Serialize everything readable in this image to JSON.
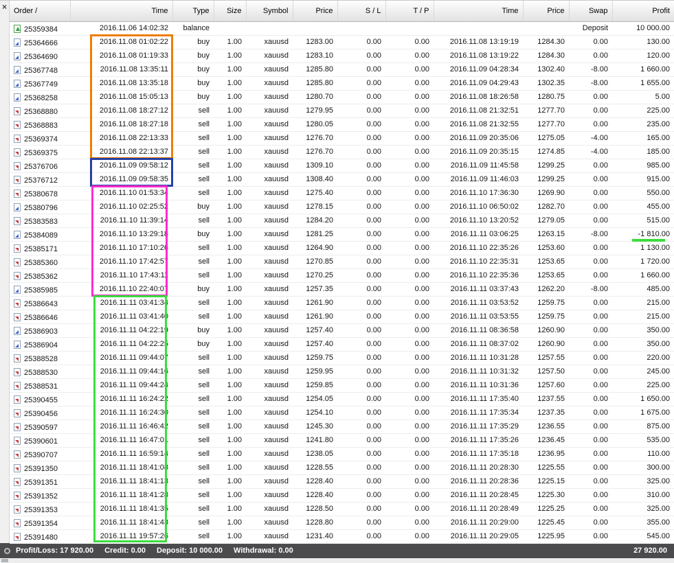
{
  "panel": {
    "close_glyph": "×"
  },
  "columns": [
    {
      "key": "order",
      "label": "Order /"
    },
    {
      "key": "time",
      "label": "Time"
    },
    {
      "key": "type",
      "label": "Type"
    },
    {
      "key": "size",
      "label": "Size"
    },
    {
      "key": "symbol",
      "label": "Symbol"
    },
    {
      "key": "price",
      "label": "Price"
    },
    {
      "key": "sl",
      "label": "S / L"
    },
    {
      "key": "tp",
      "label": "T / P"
    },
    {
      "key": "time2",
      "label": "Time"
    },
    {
      "key": "price2",
      "label": "Price"
    },
    {
      "key": "swap",
      "label": "Swap"
    },
    {
      "key": "profit",
      "label": "Profit"
    }
  ],
  "rows": [
    {
      "order": "25359384",
      "time": "2016.11.06 14:02:32",
      "type": "balance",
      "size": "",
      "symbol": "",
      "price": "",
      "sl": "",
      "tp": "",
      "time2": "",
      "price2": "",
      "swap": "Deposit",
      "profit": "10 000.00"
    },
    {
      "order": "25364666",
      "time": "2016.11.08 01:02:22",
      "type": "buy",
      "size": "1.00",
      "symbol": "xauusd",
      "price": "1283.00",
      "sl": "0.00",
      "tp": "0.00",
      "time2": "2016.11.08 13:19:19",
      "price2": "1284.30",
      "swap": "0.00",
      "profit": "130.00"
    },
    {
      "order": "25364690",
      "time": "2016.11.08 01:19:33",
      "type": "buy",
      "size": "1.00",
      "symbol": "xauusd",
      "price": "1283.10",
      "sl": "0.00",
      "tp": "0.00",
      "time2": "2016.11.08 13:19:22",
      "price2": "1284.30",
      "swap": "0.00",
      "profit": "120.00"
    },
    {
      "order": "25367748",
      "time": "2016.11.08 13:35:11",
      "type": "buy",
      "size": "1.00",
      "symbol": "xauusd",
      "price": "1285.80",
      "sl": "0.00",
      "tp": "0.00",
      "time2": "2016.11.09 04:28:34",
      "price2": "1302.40",
      "swap": "-8.00",
      "profit": "1 660.00"
    },
    {
      "order": "25367749",
      "time": "2016.11.08 13:35:18",
      "type": "buy",
      "size": "1.00",
      "symbol": "xauusd",
      "price": "1285.80",
      "sl": "0.00",
      "tp": "0.00",
      "time2": "2016.11.09 04:29:43",
      "price2": "1302.35",
      "swap": "-8.00",
      "profit": "1 655.00"
    },
    {
      "order": "25368258",
      "time": "2016.11.08 15:05:13",
      "type": "buy",
      "size": "1.00",
      "symbol": "xauusd",
      "price": "1280.70",
      "sl": "0.00",
      "tp": "0.00",
      "time2": "2016.11.08 18:26:58",
      "price2": "1280.75",
      "swap": "0.00",
      "profit": "5.00"
    },
    {
      "order": "25368880",
      "time": "2016.11.08 18:27:12",
      "type": "sell",
      "size": "1.00",
      "symbol": "xauusd",
      "price": "1279.95",
      "sl": "0.00",
      "tp": "0.00",
      "time2": "2016.11.08 21:32:51",
      "price2": "1277.70",
      "swap": "0.00",
      "profit": "225.00"
    },
    {
      "order": "25368883",
      "time": "2016.11.08 18:27:18",
      "type": "sell",
      "size": "1.00",
      "symbol": "xauusd",
      "price": "1280.05",
      "sl": "0.00",
      "tp": "0.00",
      "time2": "2016.11.08 21:32:55",
      "price2": "1277.70",
      "swap": "0.00",
      "profit": "235.00"
    },
    {
      "order": "25369374",
      "time": "2016.11.08 22:13:33",
      "type": "sell",
      "size": "1.00",
      "symbol": "xauusd",
      "price": "1276.70",
      "sl": "0.00",
      "tp": "0.00",
      "time2": "2016.11.09 20:35:06",
      "price2": "1275.05",
      "swap": "-4.00",
      "profit": "165.00"
    },
    {
      "order": "25369375",
      "time": "2016.11.08 22:13:37",
      "type": "sell",
      "size": "1.00",
      "symbol": "xauusd",
      "price": "1276.70",
      "sl": "0.00",
      "tp": "0.00",
      "time2": "2016.11.09 20:35:15",
      "price2": "1274.85",
      "swap": "-4.00",
      "profit": "185.00"
    },
    {
      "order": "25376706",
      "time": "2016.11.09 09:58:12",
      "type": "sell",
      "size": "1.00",
      "symbol": "xauusd",
      "price": "1309.10",
      "sl": "0.00",
      "tp": "0.00",
      "time2": "2016.11.09 11:45:58",
      "price2": "1299.25",
      "swap": "0.00",
      "profit": "985.00"
    },
    {
      "order": "25376712",
      "time": "2016.11.09 09:58:35",
      "type": "sell",
      "size": "1.00",
      "symbol": "xauusd",
      "price": "1308.40",
      "sl": "0.00",
      "tp": "0.00",
      "time2": "2016.11.09 11:46:03",
      "price2": "1299.25",
      "swap": "0.00",
      "profit": "915.00"
    },
    {
      "order": "25380678",
      "time": "2016.11.10 01:53:34",
      "type": "sell",
      "size": "1.00",
      "symbol": "xauusd",
      "price": "1275.40",
      "sl": "0.00",
      "tp": "0.00",
      "time2": "2016.11.10 17:36:30",
      "price2": "1269.90",
      "swap": "0.00",
      "profit": "550.00"
    },
    {
      "order": "25380796",
      "time": "2016.11.10 02:25:52",
      "type": "buy",
      "size": "1.00",
      "symbol": "xauusd",
      "price": "1278.15",
      "sl": "0.00",
      "tp": "0.00",
      "time2": "2016.11.10 06:50:02",
      "price2": "1282.70",
      "swap": "0.00",
      "profit": "455.00"
    },
    {
      "order": "25383583",
      "time": "2016.11.10 11:39:14",
      "type": "sell",
      "size": "1.00",
      "symbol": "xauusd",
      "price": "1284.20",
      "sl": "0.00",
      "tp": "0.00",
      "time2": "2016.11.10 13:20:52",
      "price2": "1279.05",
      "swap": "0.00",
      "profit": "515.00"
    },
    {
      "order": "25384089",
      "time": "2016.11.10 13:29:18",
      "type": "buy",
      "size": "1.00",
      "symbol": "xauusd",
      "price": "1281.25",
      "sl": "0.00",
      "tp": "0.00",
      "time2": "2016.11.11 03:06:25",
      "price2": "1263.15",
      "swap": "-8.00",
      "profit": "-1 810.00"
    },
    {
      "order": "25385171",
      "time": "2016.11.10 17:10:26",
      "type": "sell",
      "size": "1.00",
      "symbol": "xauusd",
      "price": "1264.90",
      "sl": "0.00",
      "tp": "0.00",
      "time2": "2016.11.10 22:35:26",
      "price2": "1253.60",
      "swap": "0.00",
      "profit": "1 130.00"
    },
    {
      "order": "25385360",
      "time": "2016.11.10 17:42:57",
      "type": "sell",
      "size": "1.00",
      "symbol": "xauusd",
      "price": "1270.85",
      "sl": "0.00",
      "tp": "0.00",
      "time2": "2016.11.10 22:35:31",
      "price2": "1253.65",
      "swap": "0.00",
      "profit": "1 720.00"
    },
    {
      "order": "25385362",
      "time": "2016.11.10 17:43:11",
      "type": "sell",
      "size": "1.00",
      "symbol": "xauusd",
      "price": "1270.25",
      "sl": "0.00",
      "tp": "0.00",
      "time2": "2016.11.10 22:35:36",
      "price2": "1253.65",
      "swap": "0.00",
      "profit": "1 660.00"
    },
    {
      "order": "25385985",
      "time": "2016.11.10 22:40:07",
      "type": "buy",
      "size": "1.00",
      "symbol": "xauusd",
      "price": "1257.35",
      "sl": "0.00",
      "tp": "0.00",
      "time2": "2016.11.11 03:37:43",
      "price2": "1262.20",
      "swap": "-8.00",
      "profit": "485.00"
    },
    {
      "order": "25386643",
      "time": "2016.11.11 03:41:34",
      "type": "sell",
      "size": "1.00",
      "symbol": "xauusd",
      "price": "1261.90",
      "sl": "0.00",
      "tp": "0.00",
      "time2": "2016.11.11 03:53:52",
      "price2": "1259.75",
      "swap": "0.00",
      "profit": "215.00"
    },
    {
      "order": "25386646",
      "time": "2016.11.11 03:41:40",
      "type": "sell",
      "size": "1.00",
      "symbol": "xauusd",
      "price": "1261.90",
      "sl": "0.00",
      "tp": "0.00",
      "time2": "2016.11.11 03:53:55",
      "price2": "1259.75",
      "swap": "0.00",
      "profit": "215.00"
    },
    {
      "order": "25386903",
      "time": "2016.11.11 04:22:19",
      "type": "buy",
      "size": "1.00",
      "symbol": "xauusd",
      "price": "1257.40",
      "sl": "0.00",
      "tp": "0.00",
      "time2": "2016.11.11 08:36:58",
      "price2": "1260.90",
      "swap": "0.00",
      "profit": "350.00"
    },
    {
      "order": "25386904",
      "time": "2016.11.11 04:22:25",
      "type": "buy",
      "size": "1.00",
      "symbol": "xauusd",
      "price": "1257.40",
      "sl": "0.00",
      "tp": "0.00",
      "time2": "2016.11.11 08:37:02",
      "price2": "1260.90",
      "swap": "0.00",
      "profit": "350.00"
    },
    {
      "order": "25388528",
      "time": "2016.11.11 09:44:07",
      "type": "sell",
      "size": "1.00",
      "symbol": "xauusd",
      "price": "1259.75",
      "sl": "0.00",
      "tp": "0.00",
      "time2": "2016.11.11 10:31:28",
      "price2": "1257.55",
      "swap": "0.00",
      "profit": "220.00"
    },
    {
      "order": "25388530",
      "time": "2016.11.11 09:44:16",
      "type": "sell",
      "size": "1.00",
      "symbol": "xauusd",
      "price": "1259.95",
      "sl": "0.00",
      "tp": "0.00",
      "time2": "2016.11.11 10:31:32",
      "price2": "1257.50",
      "swap": "0.00",
      "profit": "245.00"
    },
    {
      "order": "25388531",
      "time": "2016.11.11 09:44:24",
      "type": "sell",
      "size": "1.00",
      "symbol": "xauusd",
      "price": "1259.85",
      "sl": "0.00",
      "tp": "0.00",
      "time2": "2016.11.11 10:31:36",
      "price2": "1257.60",
      "swap": "0.00",
      "profit": "225.00"
    },
    {
      "order": "25390455",
      "time": "2016.11.11 16:24:22",
      "type": "sell",
      "size": "1.00",
      "symbol": "xauusd",
      "price": "1254.05",
      "sl": "0.00",
      "tp": "0.00",
      "time2": "2016.11.11 17:35:40",
      "price2": "1237.55",
      "swap": "0.00",
      "profit": "1 650.00"
    },
    {
      "order": "25390456",
      "time": "2016.11.11 16:24:30",
      "type": "sell",
      "size": "1.00",
      "symbol": "xauusd",
      "price": "1254.10",
      "sl": "0.00",
      "tp": "0.00",
      "time2": "2016.11.11 17:35:34",
      "price2": "1237.35",
      "swap": "0.00",
      "profit": "1 675.00"
    },
    {
      "order": "25390597",
      "time": "2016.11.11 16:46:42",
      "type": "sell",
      "size": "1.00",
      "symbol": "xauusd",
      "price": "1245.30",
      "sl": "0.00",
      "tp": "0.00",
      "time2": "2016.11.11 17:35:29",
      "price2": "1236.55",
      "swap": "0.00",
      "profit": "875.00"
    },
    {
      "order": "25390601",
      "time": "2016.11.11 16:47:01",
      "type": "sell",
      "size": "1.00",
      "symbol": "xauusd",
      "price": "1241.80",
      "sl": "0.00",
      "tp": "0.00",
      "time2": "2016.11.11 17:35:26",
      "price2": "1236.45",
      "swap": "0.00",
      "profit": "535.00"
    },
    {
      "order": "25390707",
      "time": "2016.11.11 16:59:14",
      "type": "sell",
      "size": "1.00",
      "symbol": "xauusd",
      "price": "1238.05",
      "sl": "0.00",
      "tp": "0.00",
      "time2": "2016.11.11 17:35:18",
      "price2": "1236.95",
      "swap": "0.00",
      "profit": "110.00"
    },
    {
      "order": "25391350",
      "time": "2016.11.11 18:41:08",
      "type": "sell",
      "size": "1.00",
      "symbol": "xauusd",
      "price": "1228.55",
      "sl": "0.00",
      "tp": "0.00",
      "time2": "2016.11.11 20:28:30",
      "price2": "1225.55",
      "swap": "0.00",
      "profit": "300.00"
    },
    {
      "order": "25391351",
      "time": "2016.11.11 18:41:13",
      "type": "sell",
      "size": "1.00",
      "symbol": "xauusd",
      "price": "1228.40",
      "sl": "0.00",
      "tp": "0.00",
      "time2": "2016.11.11 20:28:36",
      "price2": "1225.15",
      "swap": "0.00",
      "profit": "325.00"
    },
    {
      "order": "25391352",
      "time": "2016.11.11 18:41:28",
      "type": "sell",
      "size": "1.00",
      "symbol": "xauusd",
      "price": "1228.40",
      "sl": "0.00",
      "tp": "0.00",
      "time2": "2016.11.11 20:28:45",
      "price2": "1225.30",
      "swap": "0.00",
      "profit": "310.00"
    },
    {
      "order": "25391353",
      "time": "2016.11.11 18:41:35",
      "type": "sell",
      "size": "1.00",
      "symbol": "xauusd",
      "price": "1228.50",
      "sl": "0.00",
      "tp": "0.00",
      "time2": "2016.11.11 20:28:49",
      "price2": "1225.25",
      "swap": "0.00",
      "profit": "325.00"
    },
    {
      "order": "25391354",
      "time": "2016.11.11 18:41:43",
      "type": "sell",
      "size": "1.00",
      "symbol": "xauusd",
      "price": "1228.80",
      "sl": "0.00",
      "tp": "0.00",
      "time2": "2016.11.11 20:29:00",
      "price2": "1225.45",
      "swap": "0.00",
      "profit": "355.00"
    },
    {
      "order": "25391480",
      "time": "2016.11.11 19:57:26",
      "type": "sell",
      "size": "1.00",
      "symbol": "xauusd",
      "price": "1231.40",
      "sl": "0.00",
      "tp": "0.00",
      "time2": "2016.11.11 20:29:05",
      "price2": "1225.95",
      "swap": "0.00",
      "profit": "545.00"
    }
  ],
  "footer": {
    "items": [
      {
        "label": "Profit/Loss:",
        "value": "17 920.00"
      },
      {
        "label": "Credit:",
        "value": "0.00"
      },
      {
        "label": "Deposit:",
        "value": "10 000.00"
      },
      {
        "label": "Withdrawal:",
        "value": "0.00"
      }
    ],
    "total": "27 920.00"
  },
  "annotations": {
    "orange_box": {
      "color": "#ef7d00",
      "note": "2016.11.08 open times"
    },
    "blue_box": {
      "color": "#2540a8",
      "note": "2016.11.09 open times"
    },
    "magenta_box": {
      "color": "#ff2ccc",
      "note": "2016.11.10 open times"
    },
    "green_box": {
      "color": "#3ddc3d",
      "note": "2016.11.11 open times"
    },
    "green_underline": {
      "color": "#3ddc3d",
      "note": "underline of -1 810.00 loss"
    }
  }
}
